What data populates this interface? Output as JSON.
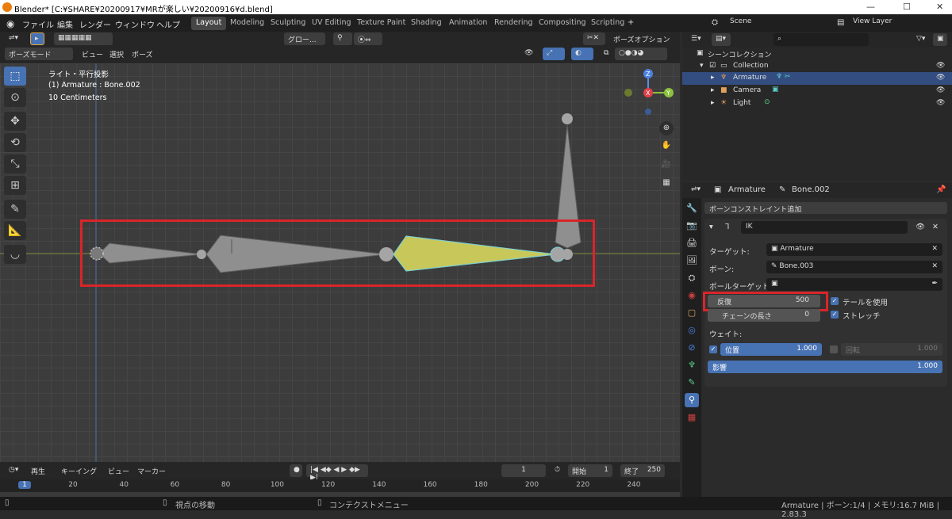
{
  "window": {
    "title": "Blender* [C:¥SHARE¥20200917¥MRが楽しい¥20200916¥d.blend]"
  },
  "menu": [
    "ファイル",
    "編集",
    "レンダー",
    "ウィンドウ",
    "ヘルプ"
  ],
  "workspaces": [
    "Layout",
    "Modeling",
    "Sculpting",
    "UV Editing",
    "Texture Paint",
    "Shading",
    "Animation",
    "Rendering",
    "Compositing",
    "Scripting"
  ],
  "scene": {
    "label": "Scene",
    "view_layer": "View Layer"
  },
  "viewport": {
    "mode": "ポーズモード",
    "menus": [
      "ビュー",
      "選択",
      "ポーズ"
    ],
    "orientation": "グロー...",
    "pose_options": "ポーズオプション",
    "info_line1": "ライト・平行投影",
    "info_line2": "(1) Armature : Bone.002",
    "info_line3": "10 Centimeters"
  },
  "outliner": {
    "header": "シーンコレクション",
    "items": [
      "Collection",
      "Armature",
      "Camera",
      "Light"
    ]
  },
  "properties": {
    "breadcrumb_obj": "Armature",
    "breadcrumb_bone": "Bone.002",
    "add_constraint": "ボーンコンストレイント追加",
    "constraint_name": "IK",
    "target_label": "ターゲット:",
    "target_value": "Armature",
    "bone_label": "ボーン:",
    "bone_value": "Bone.003",
    "pole_label": "ポールターゲット:",
    "iterations_label": "反復",
    "iterations_value": "500",
    "use_tail_label": "テールを使用",
    "chain_label": "チェーンの長さ",
    "chain_value": "0",
    "stretch_label": "ストレッチ",
    "weight_label": "ウェイト:",
    "position_label": "位置",
    "position_value": "1.000",
    "rotation_label": "回転",
    "rotation_value": "1.000",
    "influence_label": "影響",
    "influence_value": "1.000"
  },
  "timeline": {
    "menus": [
      "再生",
      "キーイング",
      "ビュー",
      "マーカー"
    ],
    "current_frame": "1",
    "start_label": "開始",
    "start_value": "1",
    "end_label": "終了",
    "end_value": "250",
    "ticks": [
      "1",
      "20",
      "40",
      "60",
      "80",
      "100",
      "120",
      "140",
      "160",
      "180",
      "200",
      "220",
      "240"
    ]
  },
  "status": {
    "left": "視点の移動",
    "mid": "コンテクストメニュー",
    "right": "Armature | ボーン:1/4 | メモリ:16.7 MiB | 2.83.3"
  },
  "colors": {
    "accent": "#4772b3",
    "highlight": "#d9252a",
    "active_bone": "#c8c85a"
  }
}
